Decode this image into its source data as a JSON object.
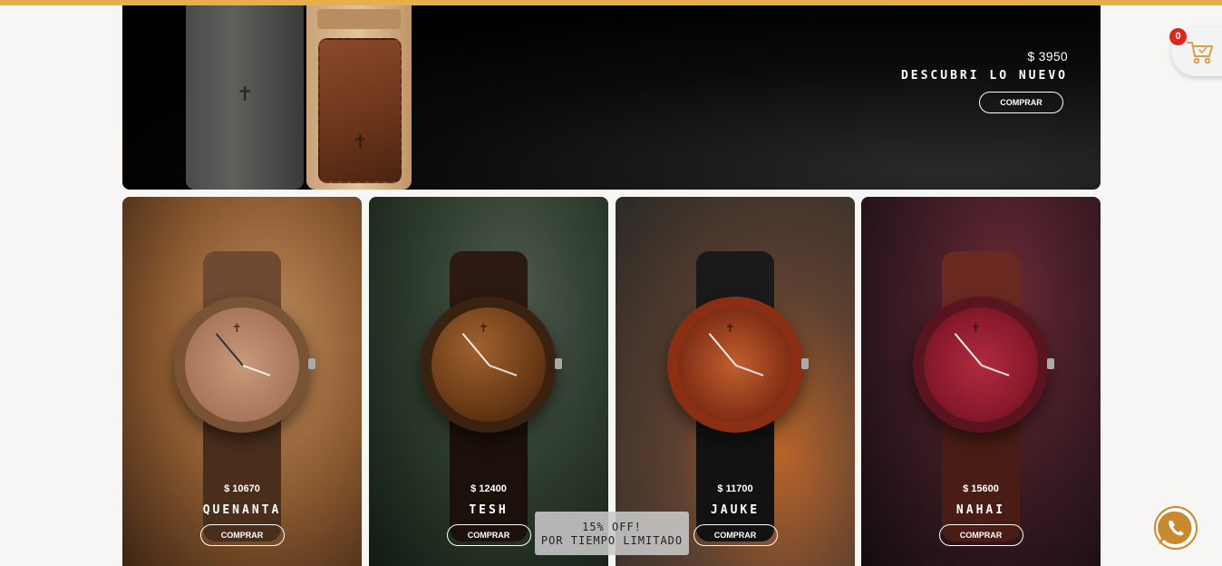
{
  "hero": {
    "price": "$ 3950",
    "title": "DESCUBRI LO NUEVO",
    "button_label": "COMPRAR",
    "brand_mark": "✝"
  },
  "products": [
    {
      "price": "$ 10670",
      "name": "QUENANTA",
      "button_label": "COMPRAR"
    },
    {
      "price": "$ 12400",
      "name": "TESH",
      "button_label": "COMPRAR"
    },
    {
      "price": "$ 11700",
      "name": "JAUKE",
      "button_label": "COMPRAR"
    },
    {
      "price": "$ 15600",
      "name": "NAHAI",
      "button_label": "COMPRAR"
    }
  ],
  "promo": {
    "line1": "15% OFF!",
    "line2": "POR TIEMPO LIMITADO"
  },
  "cart": {
    "count": "0",
    "icon": "shopping-cart-icon"
  },
  "whatsapp": {
    "icon": "whatsapp-icon"
  },
  "colors": {
    "accent": "#e8ae4c",
    "badge": "#e0241a"
  }
}
